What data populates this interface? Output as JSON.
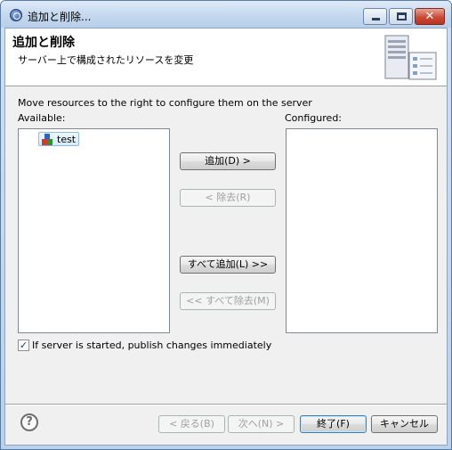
{
  "window": {
    "title": "追加と削除..."
  },
  "banner": {
    "title": "追加と削除",
    "description": "サーバー上で構成されたリソースを変更"
  },
  "body": {
    "instruction": "Move resources to the right to configure them on the server",
    "available_label": "Available:",
    "configured_label": "Configured:",
    "available_items": [
      {
        "label": "test",
        "icon": "project-icon"
      }
    ],
    "configured_items": []
  },
  "buttons": {
    "add": "追加(D) >",
    "remove": "< 除去(R)",
    "add_all": "すべて追加(L) >>",
    "remove_all": "<< すべて除去(M)",
    "back": "< 戻る(B)",
    "next": "次へ(N) >",
    "finish": "終了(F)",
    "cancel": "キャンセル"
  },
  "options": {
    "publish_label": "If server is started, publish changes immediately",
    "publish_checked": true
  },
  "colors": {
    "accent": "#3c7fb1",
    "titlebar": "#c5d9ef",
    "close": "#c94b36"
  }
}
